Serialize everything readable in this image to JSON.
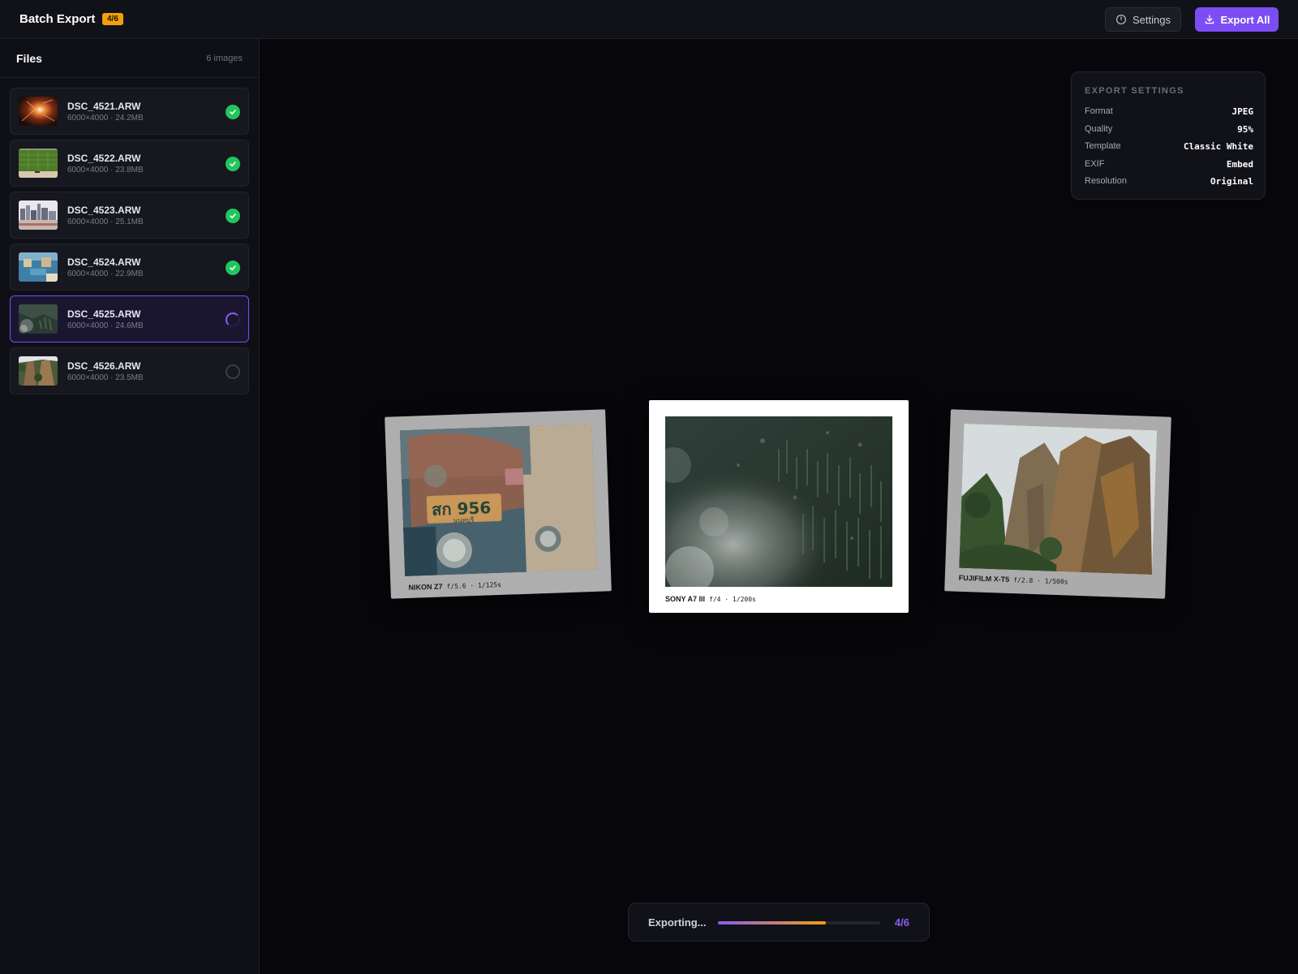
{
  "header": {
    "title": "Batch Export",
    "badge": "4/6",
    "settings_label": "Settings",
    "export_label": "Export All"
  },
  "sidebar": {
    "title": "Files",
    "count": "6 images",
    "files": [
      {
        "name": "DSC_4521.ARW",
        "meta": "6000×4000 · 24.2MB",
        "status": "done"
      },
      {
        "name": "DSC_4522.ARW",
        "meta": "6000×4000 · 23.8MB",
        "status": "done"
      },
      {
        "name": "DSC_4523.ARW",
        "meta": "6000×4000 · 25.1MB",
        "status": "done"
      },
      {
        "name": "DSC_4524.ARW",
        "meta": "6000×4000 · 22.9MB",
        "status": "done"
      },
      {
        "name": "DSC_4525.ARW",
        "meta": "6000×4000 · 24.6MB",
        "status": "in-progress"
      },
      {
        "name": "DSC_4526.ARW",
        "meta": "6000×4000 · 23.5MB",
        "status": "pending"
      }
    ]
  },
  "settings_panel": {
    "title": "EXPORT SETTINGS",
    "rows": [
      {
        "label": "Format",
        "value": "JPEG"
      },
      {
        "label": "Quality",
        "value": "95%"
      },
      {
        "label": "Template",
        "value": "Classic White"
      },
      {
        "label": "EXIF",
        "value": "Embed"
      },
      {
        "label": "Resolution",
        "value": "Original"
      }
    ]
  },
  "previews": {
    "left": {
      "camera": "NIKON Z7",
      "exposure": "f/5.6 · 1/125s"
    },
    "center": {
      "camera": "SONY A7 III",
      "exposure": "f/4 · 1/200s"
    },
    "right": {
      "camera": "FUJIFILM X-T5",
      "exposure": "f/2.8 · 1/500s"
    }
  },
  "progress": {
    "label": "Exporting...",
    "count": "4/6",
    "fraction": 0.667
  },
  "colors": {
    "accent": "#7c4df5",
    "badge": "#f59e0b",
    "success": "#22c55e"
  }
}
